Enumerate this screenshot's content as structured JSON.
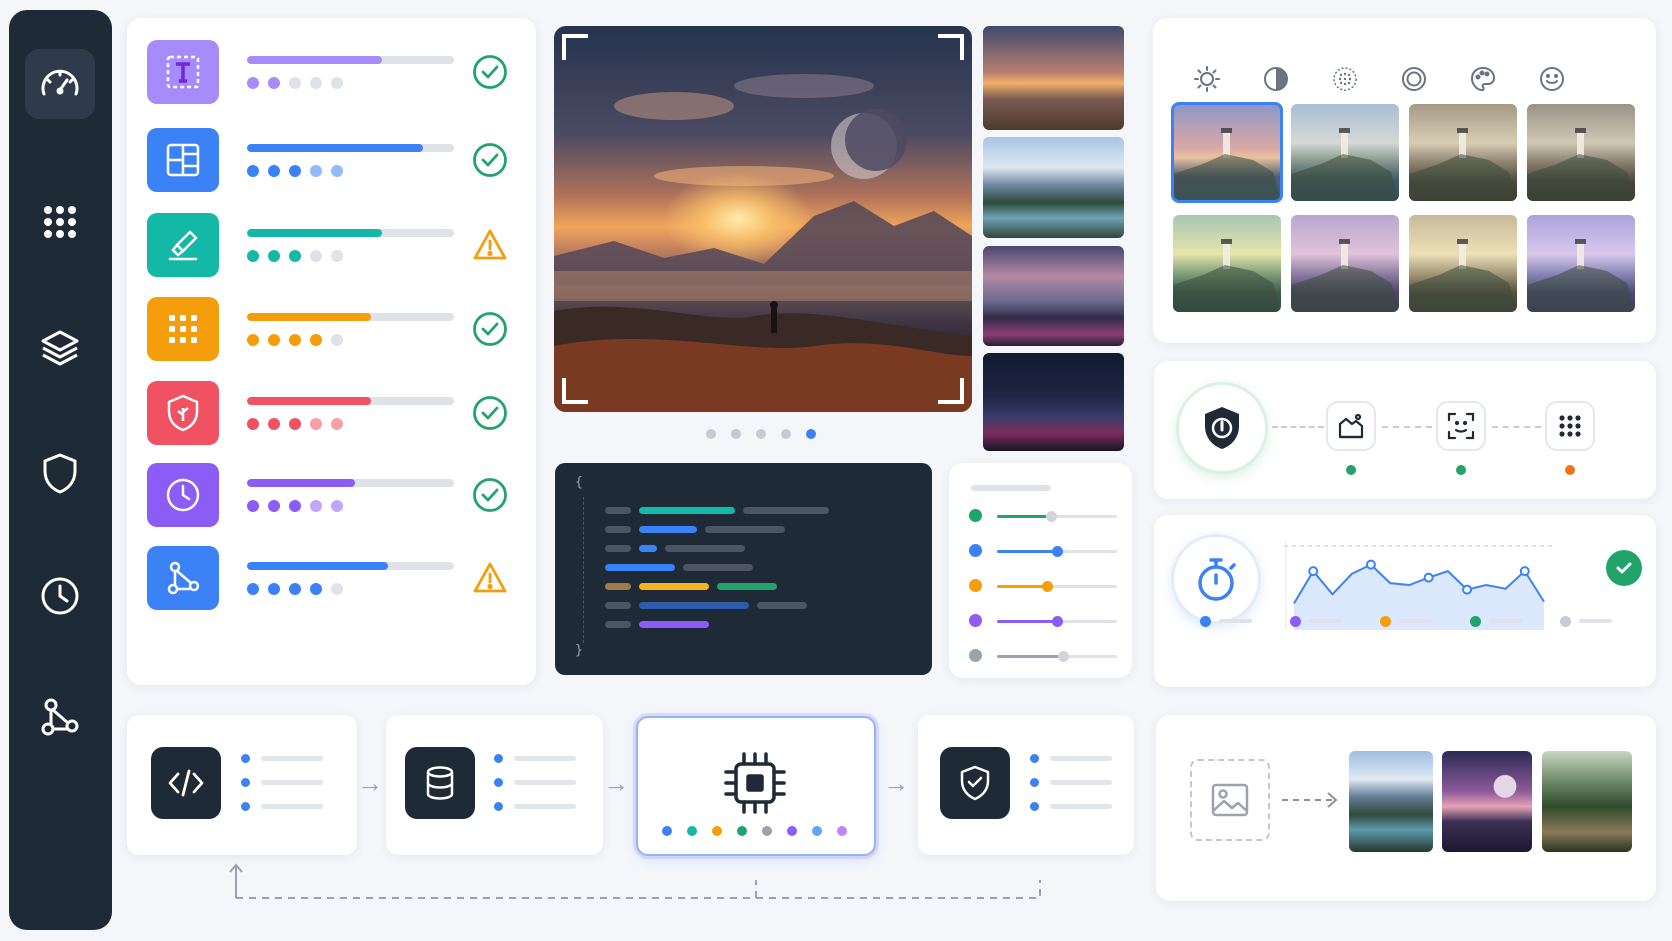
{
  "colors": {
    "sidebar": "#1f2a37",
    "accent": "#3b82f6",
    "success": "#22a36b",
    "warning": "#f59e0b"
  },
  "sidebar": {
    "items": [
      {
        "icon": "speedometer-icon",
        "active": true
      },
      {
        "icon": "apps-grid-icon",
        "active": false
      },
      {
        "icon": "layers-icon",
        "active": false
      },
      {
        "icon": "shield-icon",
        "active": false
      },
      {
        "icon": "clock-icon",
        "active": false
      },
      {
        "icon": "network-icon",
        "active": false
      }
    ]
  },
  "tasks": [
    {
      "icon": "text-tool-icon",
      "color": "#a78bfa",
      "progress": 0.65,
      "dots_filled": 2,
      "status": "success"
    },
    {
      "icon": "layout-icon",
      "color": "#3b82f6",
      "progress": 0.85,
      "dots_filled": 5,
      "status": "success"
    },
    {
      "icon": "brush-icon",
      "color": "#14b8a6",
      "progress": 0.65,
      "dots_filled": 3,
      "status": "warning"
    },
    {
      "icon": "grid-icon",
      "color": "#f59e0b",
      "progress": 0.6,
      "dots_filled": 4,
      "status": "success"
    },
    {
      "icon": "shield-leaf-icon",
      "color": "#f05262",
      "progress": 0.6,
      "dots_filled": 5,
      "status": "success"
    },
    {
      "icon": "clock-icon",
      "color": "#8b5cf6",
      "progress": 0.52,
      "dots_filled": 5,
      "status": "success"
    },
    {
      "icon": "network-icon",
      "color": "#3b82f6",
      "progress": 0.68,
      "dots_filled": 4,
      "status": "warning"
    }
  ],
  "gallery": {
    "carousel_count": 5,
    "carousel_active": 4,
    "thumbnails": [
      "sunset-lake",
      "mountain-lake",
      "purple-mountains",
      "night-city"
    ]
  },
  "code": {
    "open_brace": "{",
    "close_brace": "}"
  },
  "sliders": [
    {
      "color": "#22a36b",
      "value": 0.45
    },
    {
      "color": "#3b82f6",
      "value": 0.5
    },
    {
      "color": "#f59e0b",
      "value": 0.42
    },
    {
      "color": "#8b5cf6",
      "value": 0.5
    },
    {
      "color": "#9ca3af",
      "value": 0.55
    }
  ],
  "filters": {
    "tools": [
      "brightness-icon",
      "contrast-icon",
      "grain-icon",
      "vignette-icon",
      "palette-icon",
      "face-icon"
    ],
    "presets": [
      "original",
      "cool",
      "sepia",
      "warm-sepia",
      "vivid",
      "purple",
      "golden",
      "lavender"
    ],
    "selected": 0
  },
  "pipeline": {
    "steps": [
      {
        "icon": "image-adjust-icon",
        "status": "#22a36b"
      },
      {
        "icon": "face-scan-icon",
        "status": "#22a36b"
      },
      {
        "icon": "grid-icon",
        "status": "#f97316"
      }
    ]
  },
  "performance": {
    "values": [
      20,
      55,
      30,
      52,
      62,
      42,
      40,
      48,
      55,
      35,
      40,
      36,
      55,
      22
    ],
    "legend": [
      "#3b82f6",
      "#8b5cf6",
      "#f59e0b",
      "#22a36b",
      "#c7ccd4"
    ]
  },
  "flow": {
    "steps": [
      "code-icon",
      "database-icon",
      "chip-icon",
      "shield-check-icon"
    ],
    "chip_dots": [
      "#3b82f6",
      "#14b8a6",
      "#f59e0b",
      "#22a36b",
      "#9ca3af",
      "#8b5cf6",
      "#60a5fa",
      "#c084fc"
    ]
  },
  "generation": {
    "outputs": [
      "mountain-lake",
      "purple-planet",
      "forest-path"
    ]
  }
}
